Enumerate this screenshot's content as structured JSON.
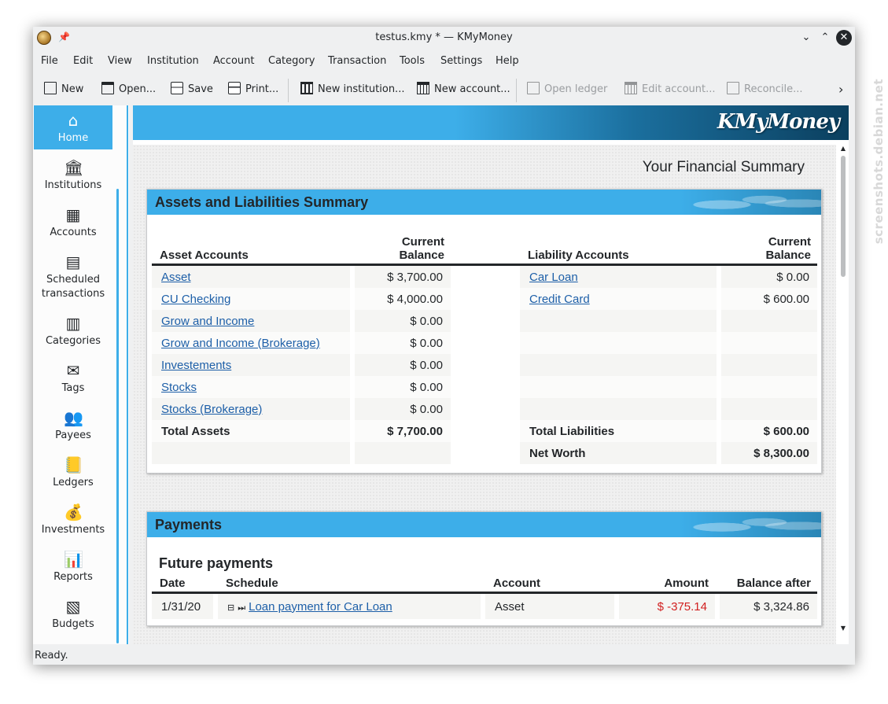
{
  "window": {
    "title": "testus.kmy * — KMyMoney"
  },
  "menu": [
    "File",
    "Edit",
    "View",
    "Institution",
    "Account",
    "Category",
    "Transaction",
    "Tools",
    "Settings",
    "Help"
  ],
  "toolbar": {
    "new": "New",
    "open": "Open...",
    "save": "Save",
    "print": "Print...",
    "new_institution": "New institution...",
    "new_account": "New account...",
    "open_ledger": "Open ledger",
    "edit_account": "Edit account...",
    "reconcile": "Reconcile..."
  },
  "sidebar": {
    "items": [
      {
        "label": "Home",
        "icon": "home-icon"
      },
      {
        "label": "Institutions",
        "icon": "institution-icon"
      },
      {
        "label": "Accounts",
        "icon": "accounts-icon"
      },
      {
        "label": "Scheduled transactions",
        "icon": "calendar-icon"
      },
      {
        "label": "Categories",
        "icon": "categories-icon"
      },
      {
        "label": "Tags",
        "icon": "tag-envelope-icon"
      },
      {
        "label": "Payees",
        "icon": "payees-icon"
      },
      {
        "label": "Ledgers",
        "icon": "ledger-icon"
      },
      {
        "label": "Investments",
        "icon": "investments-icon"
      },
      {
        "label": "Reports",
        "icon": "reports-icon"
      },
      {
        "label": "Budgets",
        "icon": "budgets-icon"
      }
    ]
  },
  "banner": {
    "logo": "KMyMoney"
  },
  "home": {
    "title": "Your Financial Summary",
    "assets_panel": {
      "title": "Assets and Liabilities Summary",
      "asset_header": "Asset Accounts",
      "asset_balance_header_1": "Current",
      "asset_balance_header_2": "Balance",
      "liability_header": "Liability Accounts",
      "liability_balance_header_1": "Current",
      "liability_balance_header_2": "Balance",
      "assets": [
        {
          "name": "Asset",
          "balance": "$ 3,700.00"
        },
        {
          "name": "CU Checking",
          "balance": "$ 4,000.00"
        },
        {
          "name": "Grow and Income",
          "balance": "$ 0.00"
        },
        {
          "name": "Grow and Income (Brokerage)",
          "balance": "$ 0.00"
        },
        {
          "name": "Investements",
          "balance": "$ 0.00"
        },
        {
          "name": "Stocks",
          "balance": "$ 0.00"
        },
        {
          "name": "Stocks (Brokerage)",
          "balance": "$ 0.00"
        }
      ],
      "liabilities": [
        {
          "name": "Car Loan",
          "balance": "$ 0.00"
        },
        {
          "name": "Credit Card",
          "balance": "$ 600.00"
        }
      ],
      "total_assets_label": "Total Assets",
      "total_assets": "$ 7,700.00",
      "total_liabilities_label": "Total Liabilities",
      "total_liabilities": "$ 600.00",
      "net_worth_label": "Net Worth",
      "net_worth": "$ 8,300.00"
    },
    "payments_panel": {
      "title": "Payments",
      "subtitle": "Future payments",
      "headers": {
        "date": "Date",
        "schedule": "Schedule",
        "account": "Account",
        "amount": "Amount",
        "balance_after": "Balance after"
      },
      "rows": [
        {
          "date": "1/31/20",
          "schedule": "Loan payment for Car Loan",
          "account": "Asset",
          "amount": "$ -375.14",
          "balance_after": "$ 3,324.86"
        }
      ]
    }
  },
  "status": {
    "text": "Ready."
  },
  "watermark": "screenshots.debian.net"
}
